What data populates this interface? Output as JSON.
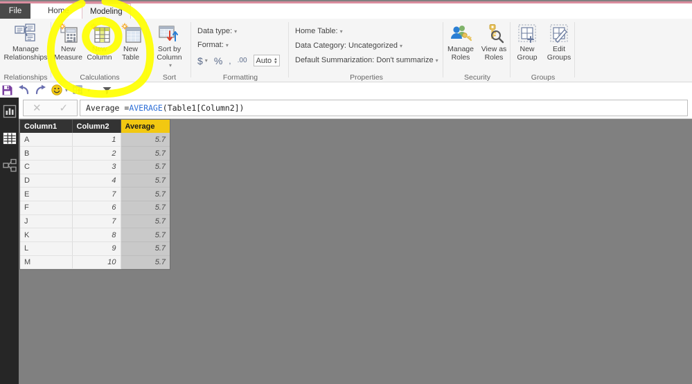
{
  "window": {
    "accent_color": "#d98c9e",
    "canvas_color": "#808080",
    "brand_gold": "#f2c811"
  },
  "tabs": {
    "file": "File",
    "items": [
      {
        "label": "Home",
        "active": false
      },
      {
        "label": "Modeling",
        "active": true
      }
    ]
  },
  "ribbon": {
    "groups": [
      {
        "name": "Relationships",
        "label": "Relationships"
      },
      {
        "name": "Calculations",
        "label": "Calculations"
      },
      {
        "name": "Sort",
        "label": "Sort"
      },
      {
        "name": "Formatting",
        "label": "Formatting"
      },
      {
        "name": "Properties",
        "label": "Properties"
      },
      {
        "name": "Security",
        "label": "Security"
      },
      {
        "name": "Groups",
        "label": "Groups"
      }
    ],
    "manage_relationships": "Manage\nRelationships",
    "new_measure": "New\nMeasure",
    "new_column": "New\nColumn",
    "new_table": "New\nTable",
    "sort_by_column": "Sort by\nColumn",
    "formatting": {
      "data_type_label": "Data type:",
      "format_label": "Format:",
      "currency_symbol": "$",
      "percent_symbol": "%",
      "comma_symbol": ",",
      "decimal_symbol": ".00",
      "auto_value": "Auto"
    },
    "properties": {
      "home_table_label": "Home Table:",
      "data_category_label": "Data Category:",
      "data_category_value": "Uncategorized",
      "default_summarization_label": "Default Summarization:",
      "default_summarization_value": "Don't summarize"
    },
    "manage_roles": "Manage\nRoles",
    "view_as_roles": "View as\nRoles",
    "new_group": "New\nGroup",
    "edit_groups": "Edit\nGroups"
  },
  "quick_access": {
    "items": [
      {
        "name": "save-icon",
        "label": "Save"
      },
      {
        "name": "undo-icon",
        "label": "Undo"
      },
      {
        "name": "redo-icon",
        "label": "Redo"
      },
      {
        "name": "smiley-icon",
        "label": "Send a Smile"
      },
      {
        "name": "refresh-table-icon",
        "label": "Refresh"
      },
      {
        "name": "filter-icon",
        "label": "Customize Quick Access Toolbar"
      }
    ]
  },
  "rail": {
    "items": [
      {
        "name": "report-view-icon",
        "label": "Report",
        "selected": false
      },
      {
        "name": "data-view-icon",
        "label": "Data",
        "selected": true
      },
      {
        "name": "model-view-icon",
        "label": "Model",
        "selected": false
      }
    ]
  },
  "formula_bar": {
    "cancel_label": "✕",
    "accept_label": "✓",
    "prefix": "Average = ",
    "function": "AVERAGE",
    "arguments": "(Table1[Column2])"
  },
  "table": {
    "columns": [
      "Column1",
      "Column2",
      "Average"
    ],
    "rows": [
      {
        "Column1": "A",
        "Column2": "1",
        "Average": "5.7"
      },
      {
        "Column1": "B",
        "Column2": "2",
        "Average": "5.7"
      },
      {
        "Column1": "C",
        "Column2": "3",
        "Average": "5.7"
      },
      {
        "Column1": "D",
        "Column2": "4",
        "Average": "5.7"
      },
      {
        "Column1": "E",
        "Column2": "7",
        "Average": "5.7"
      },
      {
        "Column1": "F",
        "Column2": "6",
        "Average": "5.7"
      },
      {
        "Column1": "J",
        "Column2": "7",
        "Average": "5.7"
      },
      {
        "Column1": "K",
        "Column2": "8",
        "Average": "5.7"
      },
      {
        "Column1": "L",
        "Column2": "9",
        "Average": "5.7"
      },
      {
        "Column1": "M",
        "Column2": "10",
        "Average": "5.7"
      }
    ]
  },
  "annotation": {
    "color": "#ffff00",
    "description": "hand-drawn highlight around New Column button"
  }
}
